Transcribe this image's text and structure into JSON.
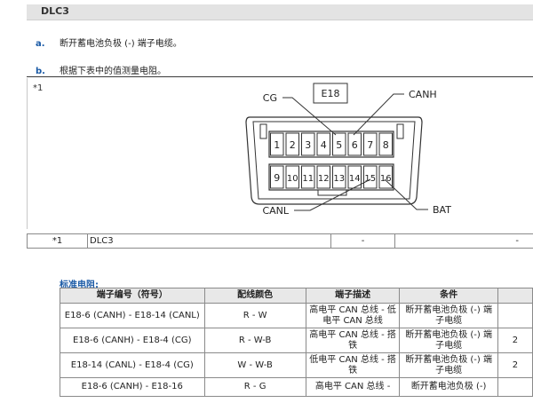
{
  "section": {
    "title": "DLC3"
  },
  "steps": [
    {
      "label": "a.",
      "text": "断开蓄电池负极 (-) 端子电缆。"
    },
    {
      "label": "b.",
      "text": "根据下表中的值测量电阻。"
    }
  ],
  "figure": {
    "note": "*1",
    "connector_label": "E18",
    "top_pins": [
      "1",
      "2",
      "3",
      "4",
      "5",
      "6",
      "7",
      "8"
    ],
    "bottom_pins": [
      "9",
      "10",
      "11",
      "12",
      "13",
      "14",
      "15",
      "16"
    ],
    "callouts": {
      "cg": "CG",
      "canh": "CANH",
      "canl": "CANL",
      "bat": "BAT"
    }
  },
  "legend": {
    "mark": "*1",
    "name": "DLC3",
    "col3": "-",
    "col4": "-"
  },
  "standard": {
    "title": "标准电阻:",
    "headers": [
      "端子编号（符号）",
      "配线颜色",
      "端子描述",
      "条件",
      ""
    ],
    "rows": [
      {
        "terminal": "E18-6 (CANH) - E18-14 (CANL)",
        "color": "R - W",
        "desc": "高电平 CAN 总线 - 低电平 CAN 总线",
        "cond": "断开蓄电池负极 (-) 端子电缆",
        "value": ""
      },
      {
        "terminal": "E18-6 (CANH) - E18-4 (CG)",
        "color": "R - W-B",
        "desc": "高电平 CAN 总线 - 搭铁",
        "cond": "断开蓄电池负极 (-) 端子电缆",
        "value": "2"
      },
      {
        "terminal": "E18-14 (CANL) - E18-4 (CG)",
        "color": "W - W-B",
        "desc": "低电平 CAN 总线 - 搭铁",
        "cond": "断开蓄电池负极 (-) 端子电缆",
        "value": "2"
      },
      {
        "terminal": "E18-6 (CANH) - E18-16",
        "color": "R - G",
        "desc": "高电平 CAN 总线 -",
        "cond": "断开蓄电池负极 (-)",
        "value": ""
      }
    ]
  }
}
